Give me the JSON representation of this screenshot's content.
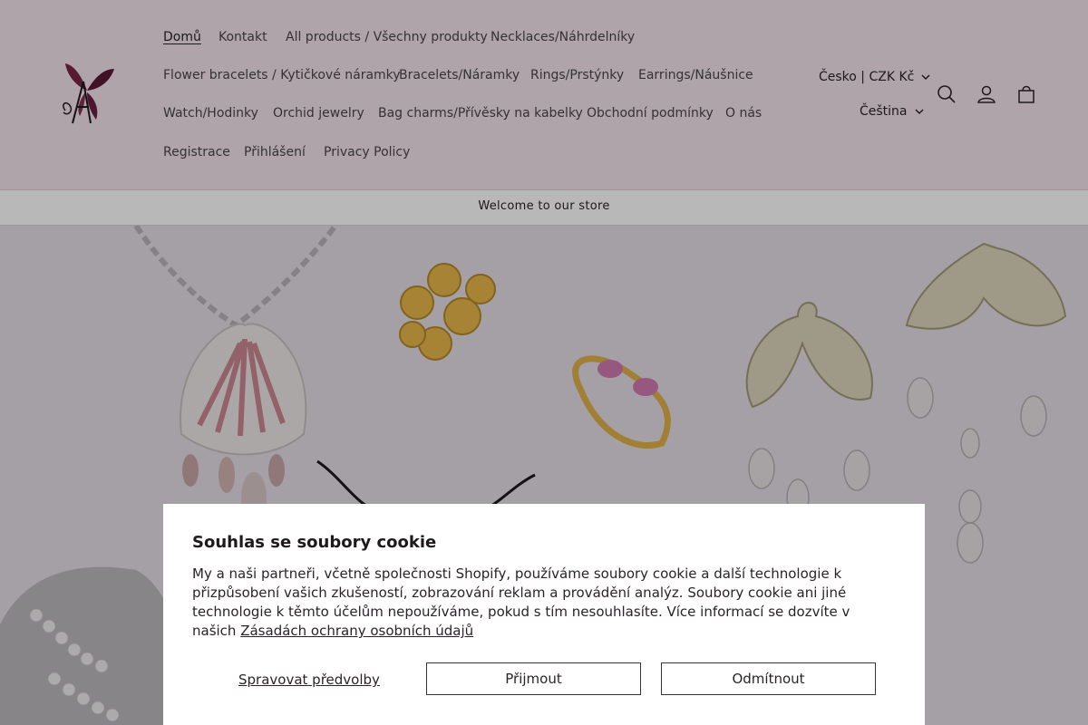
{
  "nav": {
    "items": [
      {
        "label": "Domů"
      },
      {
        "label": "Kontakt"
      },
      {
        "label": "All products / Všechny produkty"
      },
      {
        "label": "Necklaces/Náhrdelníky"
      },
      {
        "label": "Flower bracelets / Kytičkové náramky"
      },
      {
        "label": "Bracelets/Náramky"
      },
      {
        "label": "Rings/Prstýnky"
      },
      {
        "label": "Earrings/Náušnice"
      },
      {
        "label": "Watch/Hodinky"
      },
      {
        "label": "Orchid jewelry"
      },
      {
        "label": "Bag charms/Přívěsky na kabelky"
      },
      {
        "label": "Obchodní podmínky"
      },
      {
        "label": "O nás"
      },
      {
        "label": "Registrace"
      },
      {
        "label": "Přihlášení"
      },
      {
        "label": "Privacy Policy"
      }
    ]
  },
  "header": {
    "country_selector": "Česko | CZK Kč",
    "language_selector": "Čeština",
    "icons": [
      "search-icon",
      "account-icon",
      "cart-icon"
    ]
  },
  "announcement": {
    "text": "Welcome to our store"
  },
  "cookie": {
    "title": "Souhlas se soubory cookie",
    "body": "My a naši partneři, včetně společnosti Shopify, používáme soubory cookie a další technologie k přizpůsobení vašich zkušeností, zobrazování reklam a provádění analýz. Soubory cookie ani jiné technologie k těmto účelům nepoužíváme, pokud s tím nesouhlasíte. Více informací se dozvíte v našich",
    "link": "Zásadách ochrany osobních údajů",
    "manage_label": "Spravovat předvolby",
    "accept_label": "Přijmout",
    "decline_label": "Odmítnout"
  },
  "colors": {
    "header_bg": "#f2e4ec",
    "text": "#2a2428"
  }
}
